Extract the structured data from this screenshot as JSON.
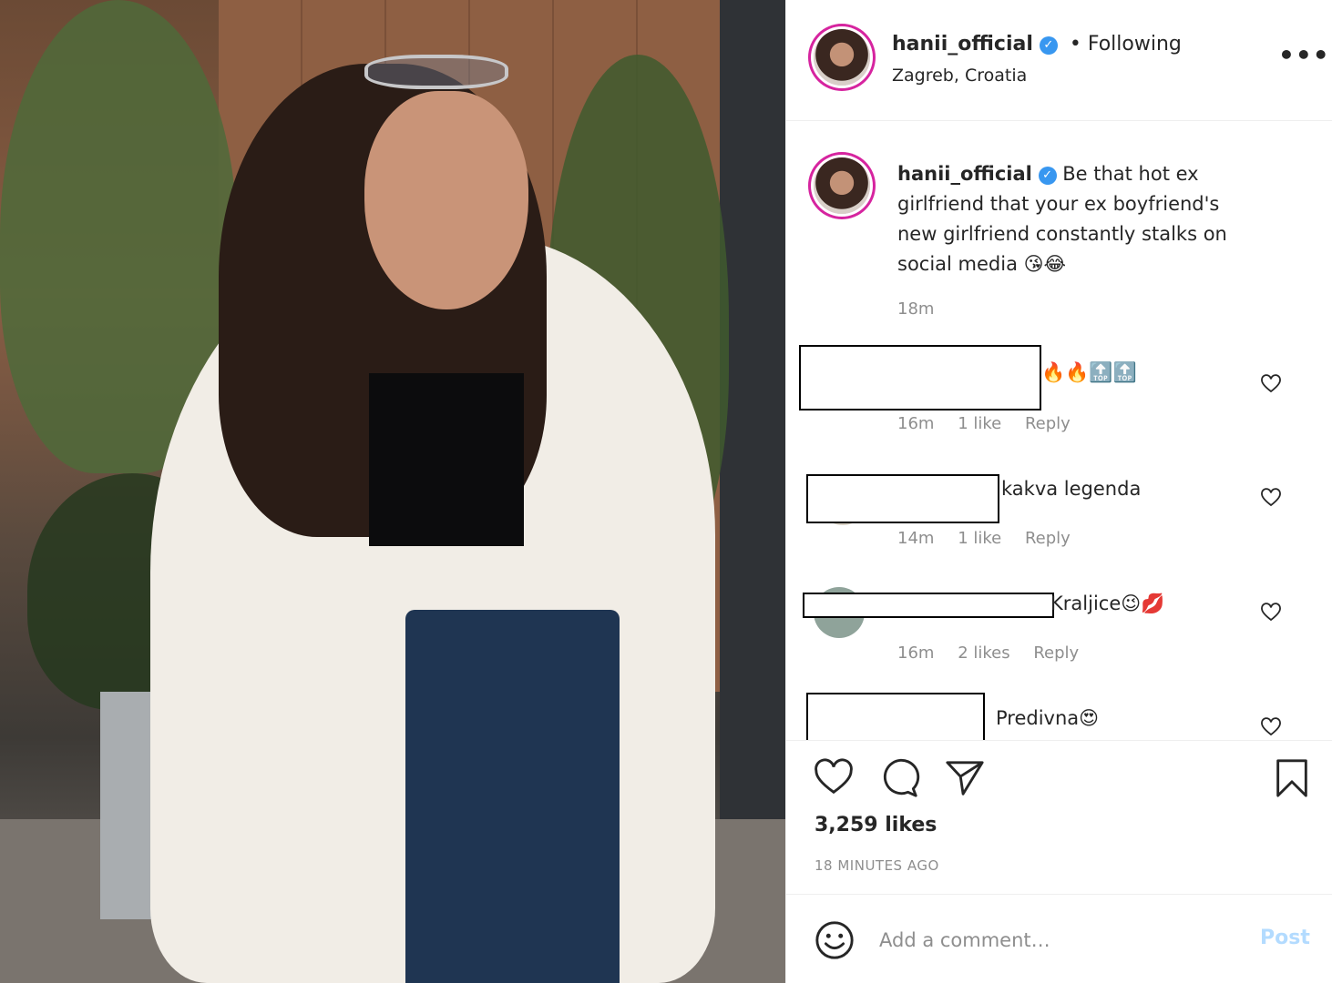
{
  "post": {
    "username": "hanii_official",
    "verified_icon": "verified-badge-icon",
    "following_label": "• Following",
    "location": "Zagreb, Croatia",
    "more_icon": "more-options-icon",
    "more_label": "•••"
  },
  "caption": {
    "username": "hanii_official",
    "text": "Be that hot ex girlfriend that your ex boyfriend's new girlfriend constantly stalks on social media 😘😂",
    "time": "18m"
  },
  "comments": [
    {
      "text": "🔥🔥🔝🔝",
      "time": "16m",
      "likes": "1 like",
      "reply": "Reply"
    },
    {
      "text": "kakva legenda",
      "time": "14m",
      "likes": "1 like",
      "reply": "Reply"
    },
    {
      "text": "Kraljice😉💋",
      "time": "16m",
      "likes": "2 likes",
      "reply": "Reply"
    },
    {
      "text": "Predivna😍",
      "time": "",
      "likes": "",
      "reply": ""
    }
  ],
  "actions": {
    "likes": "3,259 likes",
    "time_ago": "18 MINUTES AGO"
  },
  "add_comment": {
    "placeholder": "Add a comment…",
    "post_label": "Post"
  },
  "colors": {
    "accent": "#3897f0",
    "post_button": "#b3dbff",
    "muted": "#8e8e8e"
  }
}
